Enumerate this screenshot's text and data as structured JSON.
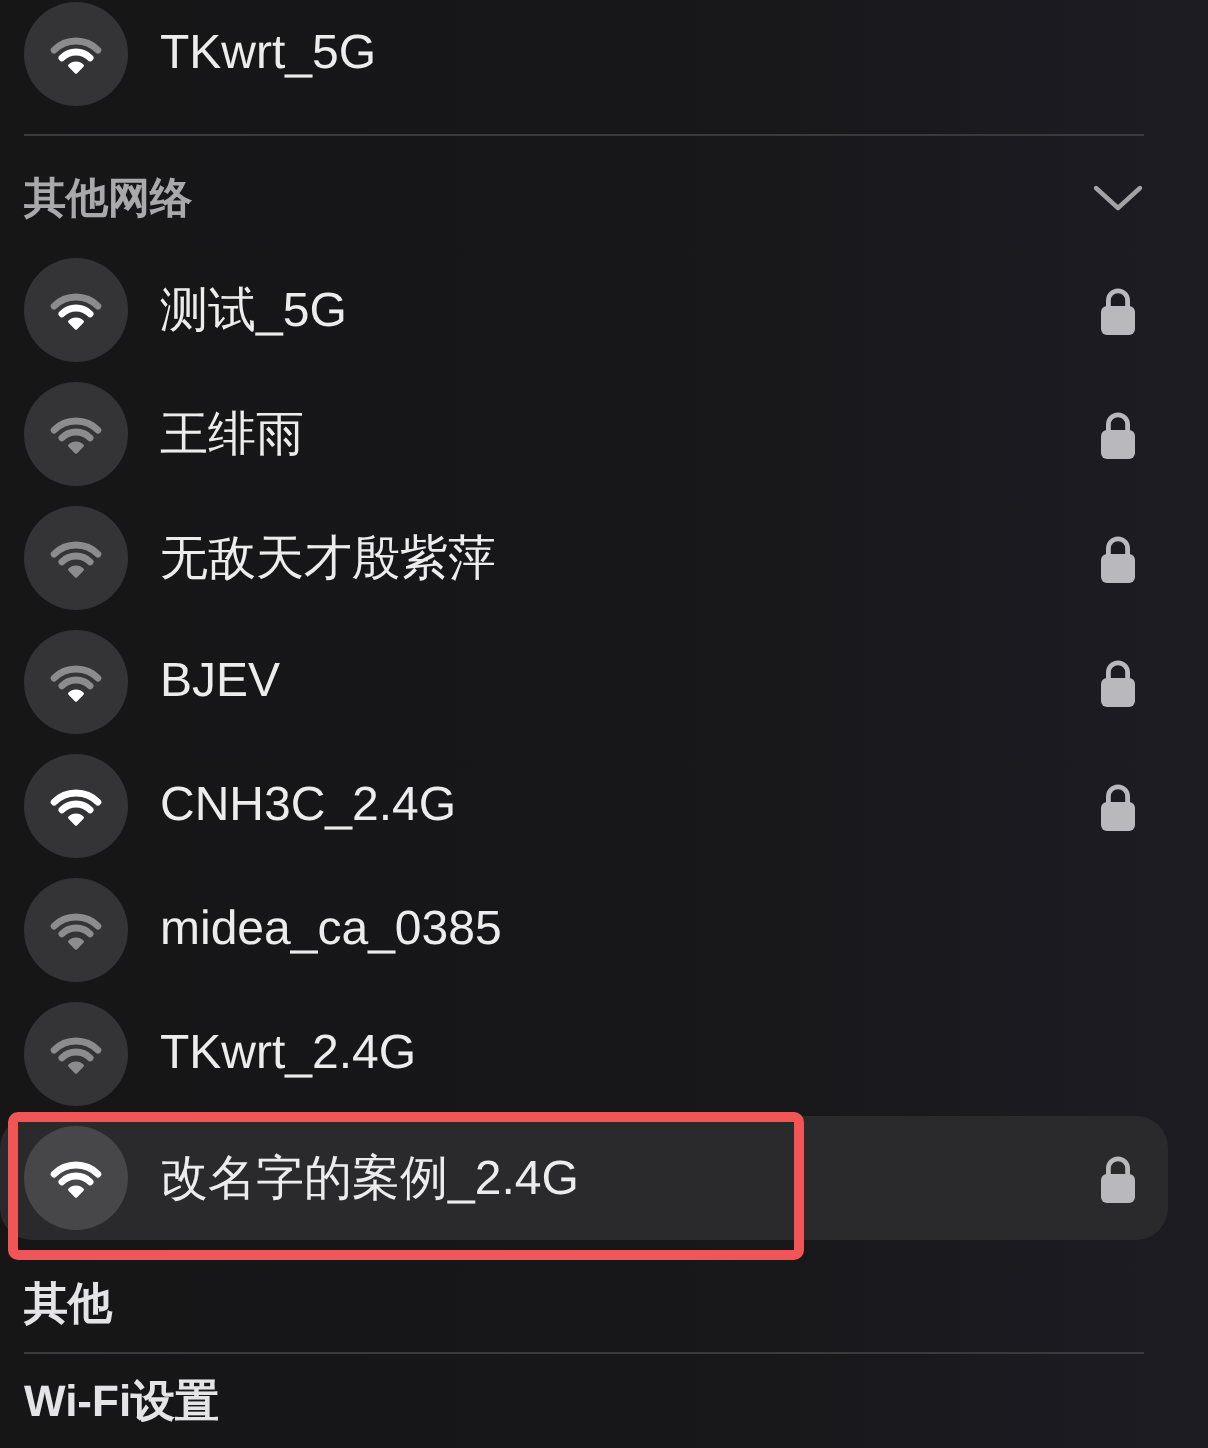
{
  "known_networks": [
    {
      "name": "TKwrt_5G",
      "kind": "good",
      "locked": false,
      "selected": false,
      "annotated": false
    }
  ],
  "other_networks": {
    "title": "其他网络",
    "expanded": true,
    "items": [
      {
        "name": "测试_5G",
        "kind": "good",
        "locked": true,
        "selected": false,
        "annotated": false
      },
      {
        "name": "王绯雨",
        "kind": "weak",
        "locked": true,
        "selected": false,
        "annotated": false
      },
      {
        "name": "无敌天才殷紫萍",
        "kind": "weak",
        "locked": true,
        "selected": false,
        "annotated": false
      },
      {
        "name": "BJEV",
        "kind": "fair",
        "locked": true,
        "selected": false,
        "annotated": false
      },
      {
        "name": "CNH3C_2.4G",
        "kind": "full",
        "locked": true,
        "selected": false,
        "annotated": false
      },
      {
        "name": "midea_ca_0385",
        "kind": "weak",
        "locked": false,
        "selected": false,
        "annotated": false
      },
      {
        "name": "TKwrt_2.4G",
        "kind": "weak",
        "locked": false,
        "selected": false,
        "annotated": false
      },
      {
        "name": "改名字的案例_2.4G",
        "kind": "full",
        "locked": true,
        "selected": true,
        "annotated": true
      }
    ]
  },
  "menu_items": [
    {
      "label": "其他"
    },
    {
      "label": "Wi-Fi设置"
    }
  ]
}
